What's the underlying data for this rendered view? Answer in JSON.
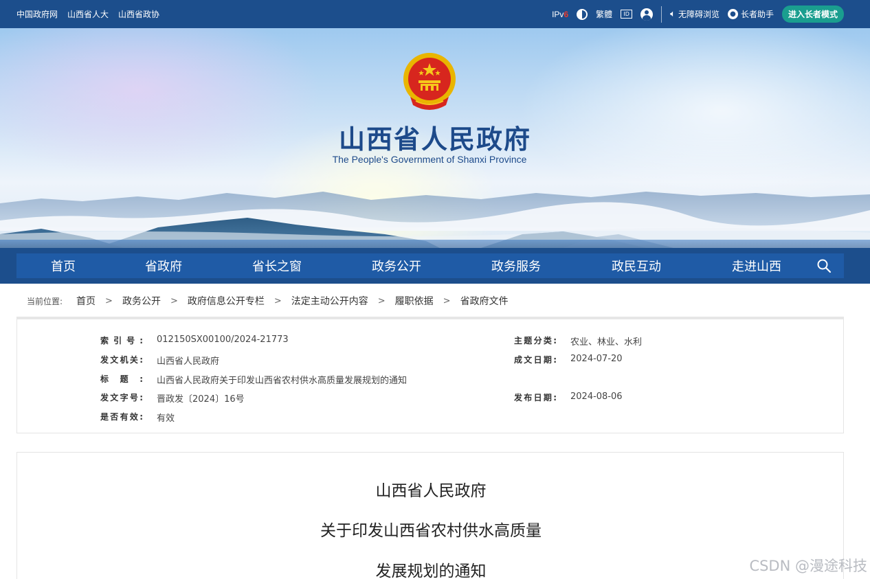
{
  "topbar": {
    "links": [
      "中国政府网",
      "山西省人大",
      "山西省政协"
    ],
    "ipv6_prefix": "IPv",
    "ipv6_suffix": "6",
    "traditional": "繁體",
    "accessibility": "无障碍浏览",
    "elder_helper": "长者助手",
    "elder_mode": "进入长者模式"
  },
  "banner": {
    "title": "山西省人民政府",
    "subtitle": "The People's Government of Shanxi Province"
  },
  "nav": {
    "items": [
      "首页",
      "省政府",
      "省长之窗",
      "政务公开",
      "政务服务",
      "政民互动",
      "走进山西"
    ]
  },
  "breadcrumb": {
    "label": "当前位置:",
    "items": [
      "首页",
      "政务公开",
      "政府信息公开专栏",
      "法定主动公开内容",
      "履职依据",
      "省政府文件"
    ],
    "separator": ">"
  },
  "info": {
    "index_key": "索引号:",
    "index_val": "012150SX00100/2024-21773",
    "topic_key": "主题分类:",
    "topic_val": "农业、林业、水利",
    "issuer_key": "发文机关:",
    "issuer_val": "山西省人民政府",
    "date_key": "成文日期:",
    "date_val": "2024-07-20",
    "title_key": "标题:",
    "title_val": "山西省人民政府关于印发山西省农村供水高质量发展规划的通知",
    "docno_key": "发文字号:",
    "docno_val": "晋政发〔2024〕16号",
    "pub_key": "发布日期:",
    "pub_val": "2024-08-06",
    "valid_key": "是否有效:",
    "valid_val": "有效"
  },
  "document": {
    "line1": "山西省人民政府",
    "line2": "关于印发山西省农村供水高质量",
    "line3": "发展规划的通知"
  },
  "watermark": "CSDN @漫途科技",
  "colors": {
    "topbar": "#1c4e8c",
    "nav": "#1f5ba6",
    "title": "#1d4a8a",
    "elder_button": "#1a9e8f",
    "ipv6_accent": "#e83b2e"
  }
}
